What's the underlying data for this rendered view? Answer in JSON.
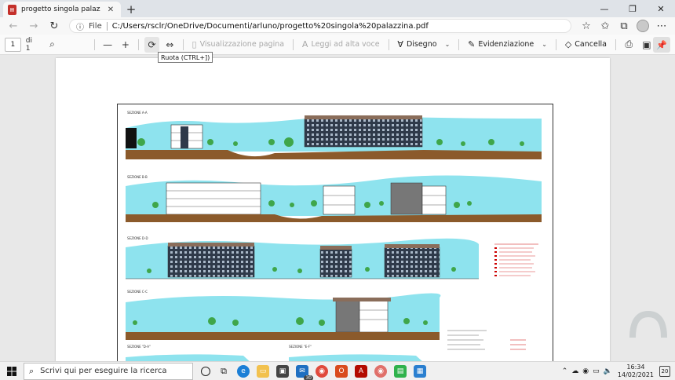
{
  "browser": {
    "tab_title": "progetto singola palazzina.pdf",
    "tab_icon": "pdf-icon",
    "url_scheme": "File",
    "url": "C:/Users/rsclr/OneDrive/Documenti/arluno/progetto%20singola%20palazzina.pdf"
  },
  "pdf_toolbar": {
    "page_number": "1",
    "page_of": "di 1",
    "page_view_label": "Visualizzazione pagina",
    "read_aloud_label": "Leggi ad alta voce",
    "draw_label": "Disegno",
    "highlight_label": "Evidenziazione",
    "erase_label": "Cancella",
    "tooltip": "Ruota (CTRL+])"
  },
  "drawing": {
    "section_labels": [
      "SEZIONE A-A",
      "SEZIONE B-B",
      "SEZIONE D-D",
      "SEZIONE C-C",
      "SEZIONE \"D-A\"",
      "SEZIONE \"E-F\""
    ],
    "sky_color": "#8ee3ee",
    "ground_color": "#8b5a2b",
    "building_color": "#2f3a4a",
    "tree_color": "#3fa64a"
  },
  "taskbar": {
    "search_placeholder": "Scrivi qui per eseguire la ricerca",
    "mail_badge": "30",
    "time": "16:34",
    "date": "14/02/2021",
    "notifications": "20"
  }
}
